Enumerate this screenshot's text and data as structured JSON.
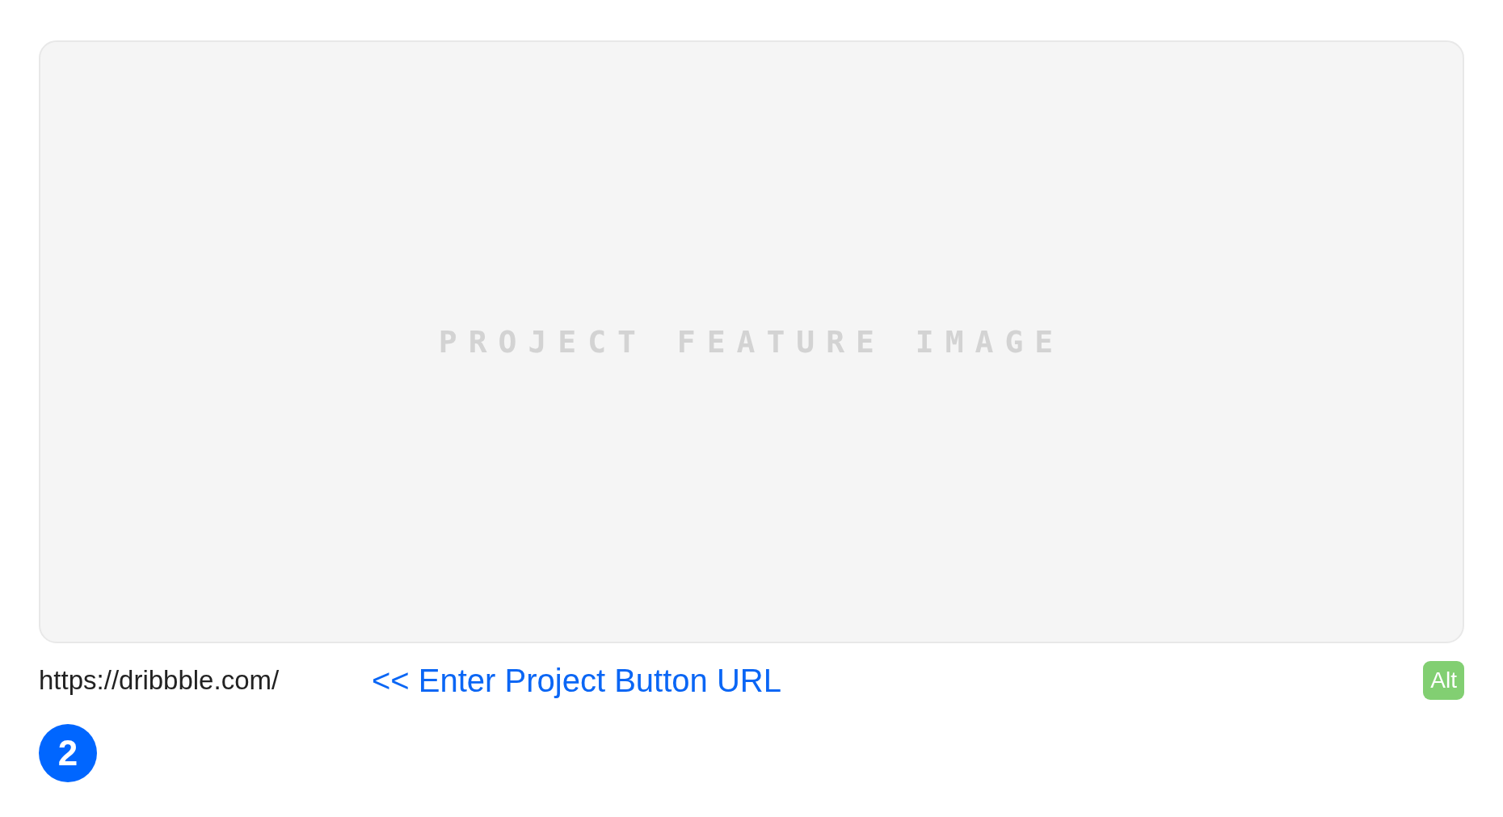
{
  "feature_image": {
    "placeholder": "PROJECT FEATURE IMAGE"
  },
  "url_field": {
    "value": "https://dribbble.com/"
  },
  "hint": "<< Enter Project Button URL",
  "alt_badge": "Alt",
  "step_number": "2"
}
